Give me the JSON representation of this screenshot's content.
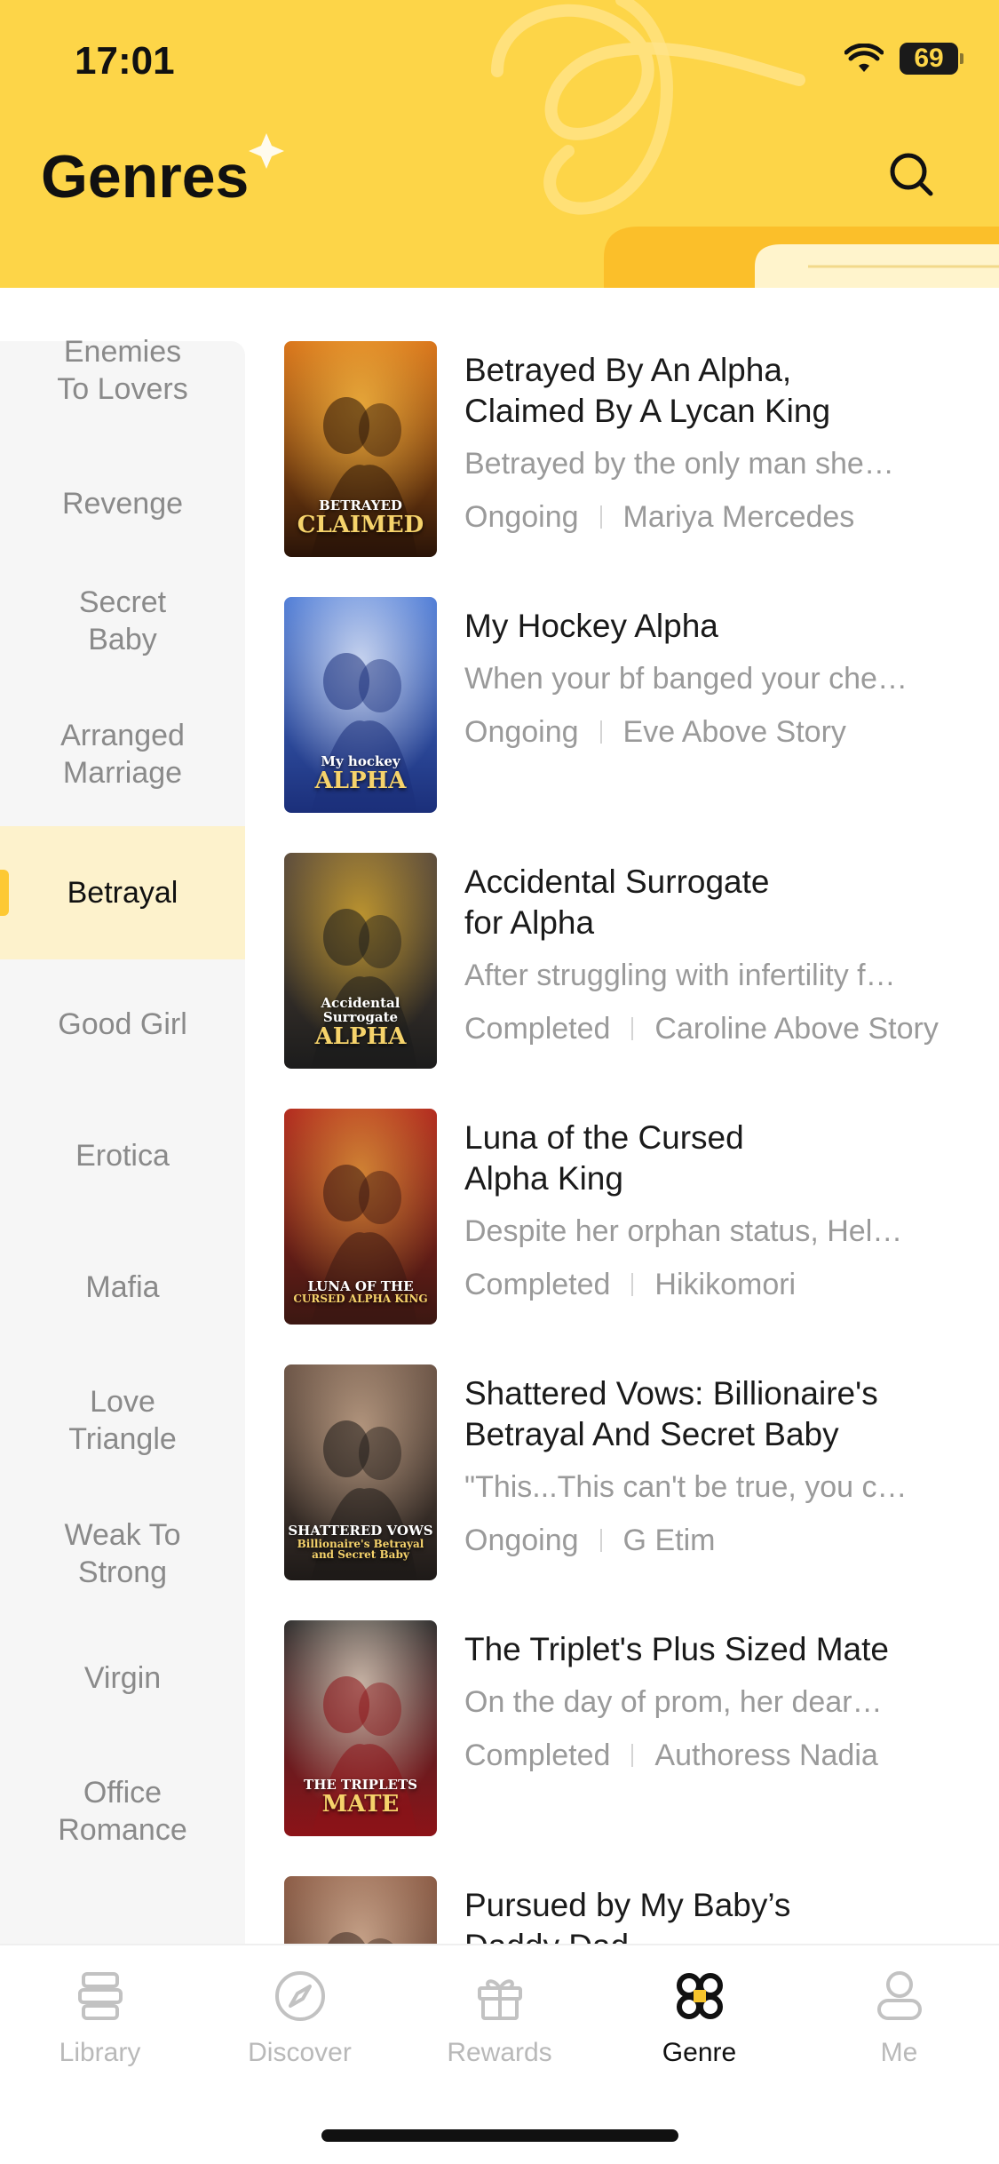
{
  "status_bar": {
    "time": "17:01",
    "battery": "69"
  },
  "header": {
    "title": "Genres"
  },
  "genres": [
    {
      "label": "Enemies\nTo Lovers",
      "active": false
    },
    {
      "label": "Revenge",
      "active": false
    },
    {
      "label": "Secret\nBaby",
      "active": false
    },
    {
      "label": "Arranged\nMarriage",
      "active": false
    },
    {
      "label": "Betrayal",
      "active": true
    },
    {
      "label": "Good Girl",
      "active": false
    },
    {
      "label": "Erotica",
      "active": false
    },
    {
      "label": "Mafia",
      "active": false
    },
    {
      "label": "Love\nTriangle",
      "active": false
    },
    {
      "label": "Weak To\nStrong",
      "active": false
    },
    {
      "label": "Virgin",
      "active": false
    },
    {
      "label": "Office\nRomance",
      "active": false
    }
  ],
  "books": [
    {
      "title": "Betrayed By An Alpha,\nClaimed By A Lycan King",
      "description": "Betrayed by the only man she…",
      "status": "Ongoing",
      "author": "Mariya Mercedes",
      "cover_text": "BETRAYED",
      "cover_text2": "CLAIMED",
      "cover_colors": [
        "#2a1408",
        "#d9731a",
        "#f5b942"
      ]
    },
    {
      "title": "My Hockey Alpha",
      "description": "When your bf banged your che…",
      "status": "Ongoing",
      "author": "Eve Above Story",
      "cover_text": "My hockey",
      "cover_text2": "ALPHA",
      "cover_colors": [
        "#1b2f7a",
        "#4d7bd6",
        "#e8eefb"
      ]
    },
    {
      "title": "Accidental Surrogate\nfor Alpha",
      "description": "After struggling with infertility f…",
      "status": "Completed",
      "author": "Caroline Above Story",
      "cover_text": "Accidental Surrogate",
      "cover_text2": "ALPHA",
      "cover_colors": [
        "#1c1c1c",
        "#5a4b3e",
        "#d8a92e"
      ]
    },
    {
      "title": "Luna of the Cursed\nAlpha King",
      "description": "Despite her orphan status, Hel…",
      "status": "Completed",
      "author": "Hikikomori",
      "cover_text": "LUNA OF THE",
      "cover_text2": "CURSED ALPHA KING",
      "cover_colors": [
        "#3b1712",
        "#b2281f",
        "#e09a3a"
      ]
    },
    {
      "title": "Shattered Vows: Billionaire's\nBetrayal And Secret Baby",
      "description": "\"This...This can't be true, you c…",
      "status": "Ongoing",
      "author": "G Etim",
      "cover_text": "SHATTERED VOWS",
      "cover_text2": "Billionaire's Betrayal and Secret Baby",
      "cover_colors": [
        "#1e1a18",
        "#6b5446",
        "#c9a98e"
      ]
    },
    {
      "title": "The Triplet's Plus Sized Mate",
      "description": "On the day of prom, her dear…",
      "status": "Completed",
      "author": "Authoress Nadia",
      "cover_text": "THE TRIPLETS",
      "cover_text2": "MATE",
      "cover_colors": [
        "#8c1318",
        "#2a2a2a",
        "#e6d6c4"
      ]
    },
    {
      "title": "Pursued by My Baby’s\nDaddy Dad",
      "description": "",
      "status": "",
      "author": "",
      "cover_text": "",
      "cover_text2": "",
      "cover_colors": [
        "#3c2a22",
        "#8a5a44",
        "#d9b59a"
      ]
    }
  ],
  "tabs": [
    {
      "label": "Library",
      "icon": "library-icon",
      "active": false
    },
    {
      "label": "Discover",
      "icon": "compass-icon",
      "active": false
    },
    {
      "label": "Rewards",
      "icon": "gift-icon",
      "active": false
    },
    {
      "label": "Genre",
      "icon": "genre-icon",
      "active": true
    },
    {
      "label": "Me",
      "icon": "profile-icon",
      "active": false
    }
  ],
  "colors": {
    "accent": "#fdd548",
    "active_bg": "#fdf2cc",
    "muted": "#9a9a9a"
  }
}
